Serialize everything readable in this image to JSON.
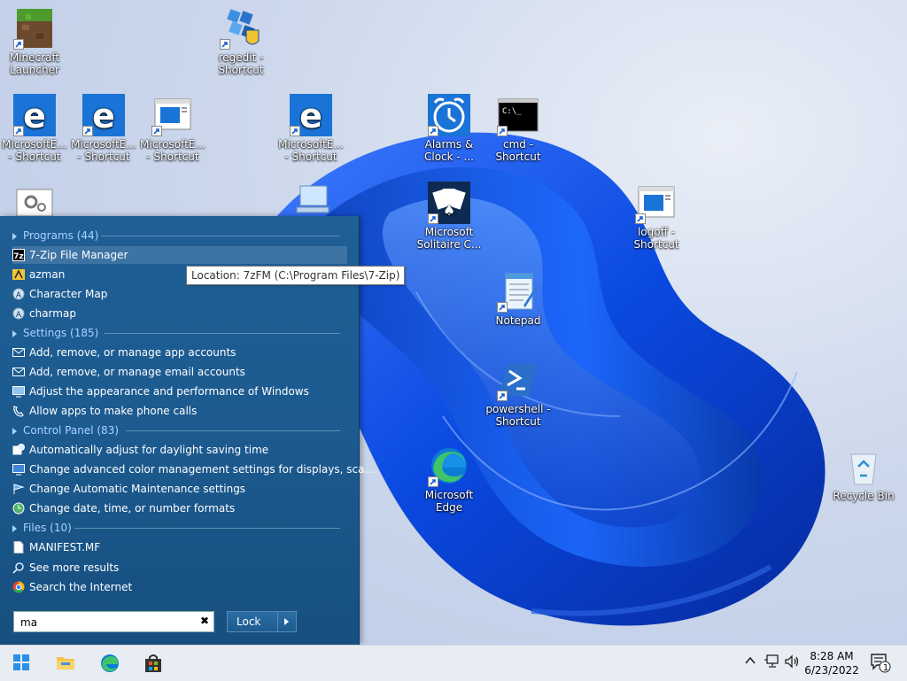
{
  "desktop": {
    "icons": [
      {
        "id": "minecraft",
        "line1": "Minecraft",
        "line2": "Launcher"
      },
      {
        "id": "regedit",
        "line1": "regedit -",
        "line2": "Shortcut"
      },
      {
        "id": "edge1",
        "line1": "MicrosoftE...",
        "line2": "- Shortcut"
      },
      {
        "id": "edge2",
        "line1": "MicrosoftE...",
        "line2": "- Shortcut"
      },
      {
        "id": "win1",
        "line1": "MicrosoftE...",
        "line2": "- Shortcut"
      },
      {
        "id": "edge3",
        "line1": "MicrosoftE...",
        "line2": "- Shortcut"
      },
      {
        "id": "alarms",
        "line1": "Alarms &",
        "line2": "Clock - ..."
      },
      {
        "id": "cmd",
        "line1": "cmd -",
        "line2": "Shortcut"
      },
      {
        "id": "solitaire",
        "line1": "Microsoft",
        "line2": "Solitaire C..."
      },
      {
        "id": "logoff",
        "line1": "logoff -",
        "line2": "Shortcut"
      },
      {
        "id": "notepad",
        "line1": "Notepad",
        "line2": ""
      },
      {
        "id": "powershell",
        "line1": "powershell -",
        "line2": "Shortcut"
      },
      {
        "id": "msedge",
        "line1": "Microsoft",
        "line2": "Edge"
      },
      {
        "id": "recycle",
        "line1": "Recycle Bin",
        "line2": ""
      }
    ]
  },
  "start_menu": {
    "sections": {
      "programs": {
        "title": "Programs (44)",
        "items": [
          "7-Zip File Manager",
          "azman",
          "Character Map",
          "charmap"
        ]
      },
      "settings": {
        "title": "Settings (185)",
        "items": [
          "Add, remove, or manage app accounts",
          "Add, remove, or manage email accounts",
          "Adjust the appearance and performance of Windows",
          "Allow apps to make phone calls"
        ]
      },
      "control_panel": {
        "title": "Control Panel (83)",
        "items": [
          "Automatically adjust for daylight saving time",
          "Change advanced color management settings for displays, sca...",
          "Change Automatic Maintenance settings",
          "Change date, time, or number formats"
        ]
      },
      "files": {
        "title": "Files (10)",
        "items": [
          "MANIFEST.MF"
        ]
      }
    },
    "see_more": "See more results",
    "search_internet": "Search the Internet",
    "search_value": "ma",
    "clear_glyph": "✖",
    "lock_label": "Lock"
  },
  "tooltip": "Location: 7zFM (C:\\Program Files\\7-Zip)",
  "taskbar": {
    "time": "8:28 AM",
    "date": "6/23/2022",
    "notification_count": "1"
  },
  "colors": {
    "start_bg": "#1c5a8f",
    "section_header": "#a9d3ff",
    "taskbar_bg": "#e8edf4",
    "accent_blue": "#0a64d8"
  }
}
